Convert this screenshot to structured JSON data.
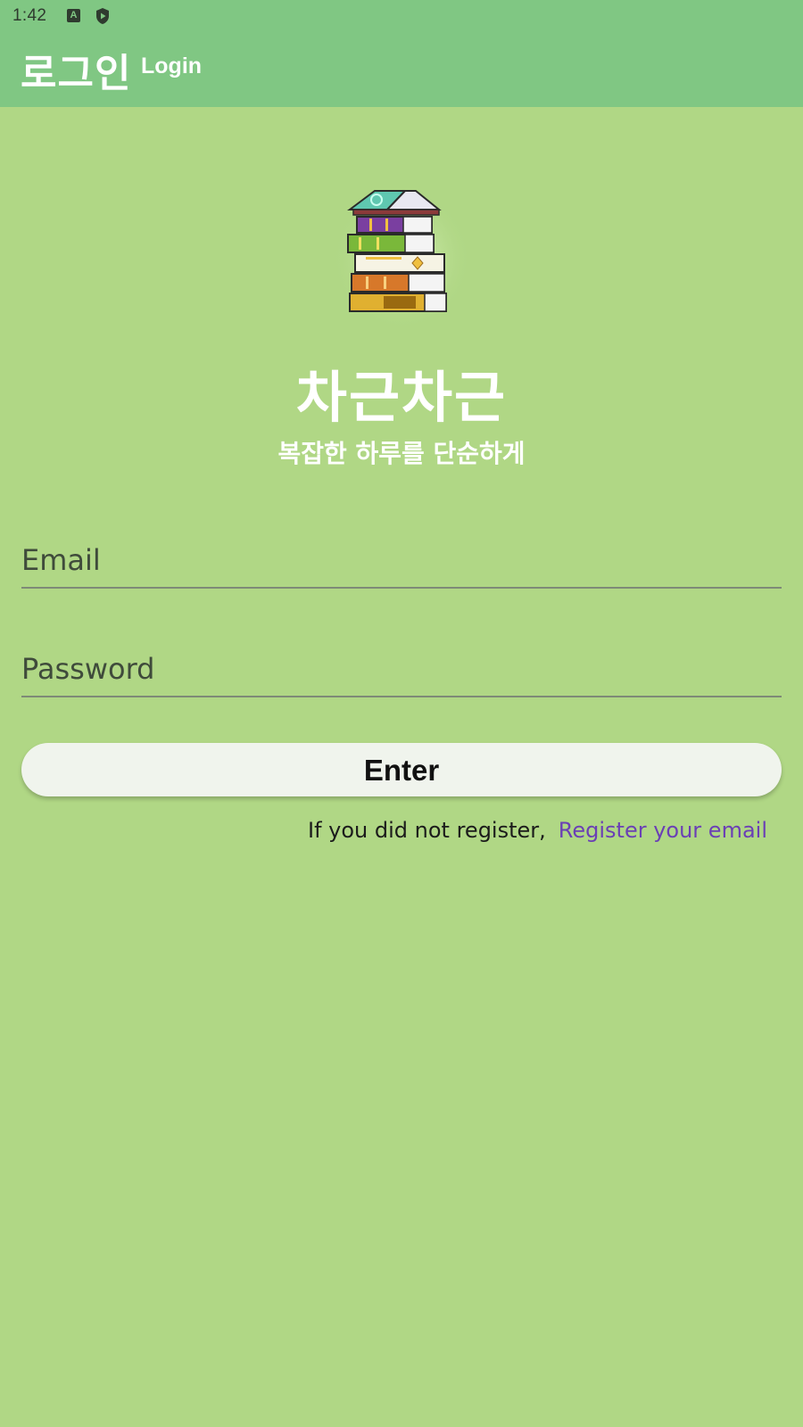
{
  "status_bar": {
    "time": "1:42",
    "icons": [
      "a-icon",
      "shield-icon"
    ]
  },
  "app_bar": {
    "title_kr": "로그인",
    "title_en": "Login"
  },
  "brand": {
    "logo": "book-stack-icon",
    "title": "차근차근",
    "subtitle": "복잡한 하루를 단순하게"
  },
  "form": {
    "email_placeholder": "Email",
    "password_placeholder": "Password",
    "enter_label": "Enter"
  },
  "register": {
    "prompt": "If you did not register,",
    "link": "Register your email"
  },
  "colors": {
    "background": "#b0d785",
    "app_bar": "#80c783",
    "link": "#6a3fb5",
    "button": "#f0f4ed"
  }
}
